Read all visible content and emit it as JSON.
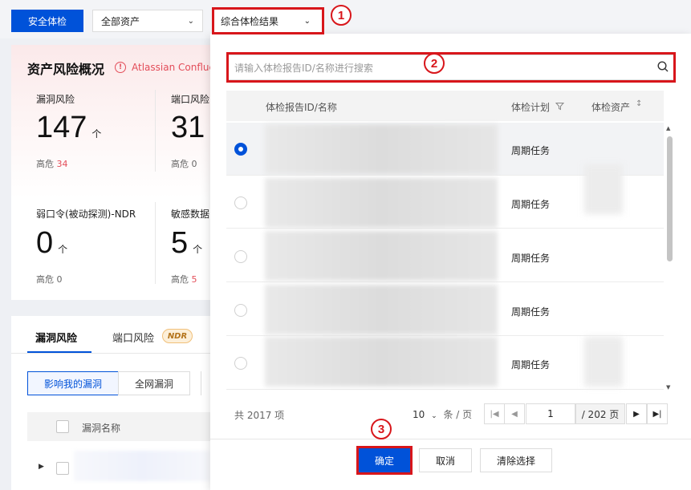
{
  "toolbar": {
    "security_check": "安全体检",
    "asset_scope": "全部资产",
    "result_select": "综合体检结果"
  },
  "risk": {
    "title": "资产风险概况",
    "alert": "Atlassian Confluen",
    "stats": [
      {
        "label": "漏洞风险",
        "value": "147",
        "unit": "个",
        "sub_label": "高危",
        "sub_value": "34"
      },
      {
        "label": "端口风险",
        "value": "31",
        "unit": "",
        "sub_label": "高危",
        "sub_value": "0"
      },
      {
        "label": "弱口令(被动探测)-NDR",
        "value": "0",
        "unit": "个",
        "sub_label": "高危",
        "sub_value": "0"
      },
      {
        "label": "敏感数据",
        "value": "5",
        "unit": "个",
        "sub_label": "高危",
        "sub_value": "5"
      }
    ]
  },
  "tabs": [
    {
      "label": "漏洞风险"
    },
    {
      "label": "端口风险"
    }
  ],
  "ndr_badge": "NDR",
  "filters": {
    "mine": "影响我的漏洞",
    "all": "全网漏洞"
  },
  "vuln_table": {
    "col_name": "漏洞名称"
  },
  "popup": {
    "search_placeholder": "请输入体检报告ID/名称进行搜索",
    "columns": {
      "name": "体检报告ID/名称",
      "plan": "体检计划",
      "asset": "体检资产"
    },
    "rows": [
      {
        "plan": "周期任务",
        "selected": true
      },
      {
        "plan": "周期任务",
        "selected": false
      },
      {
        "plan": "周期任务",
        "selected": false
      },
      {
        "plan": "周期任务",
        "selected": false
      },
      {
        "plan": "周期任务",
        "selected": false
      }
    ],
    "pagination": {
      "total": "共 2017 项",
      "page_size": "10",
      "page_size_unit": "条 / 页",
      "current": "1",
      "total_pages": "/ 202 页"
    },
    "buttons": {
      "confirm": "确定",
      "cancel": "取消",
      "clear": "清除选择"
    }
  },
  "callouts": [
    "1",
    "2",
    "3"
  ],
  "colors": {
    "primary": "#0052d9",
    "danger": "#e34d59",
    "callout": "#d8161b"
  }
}
